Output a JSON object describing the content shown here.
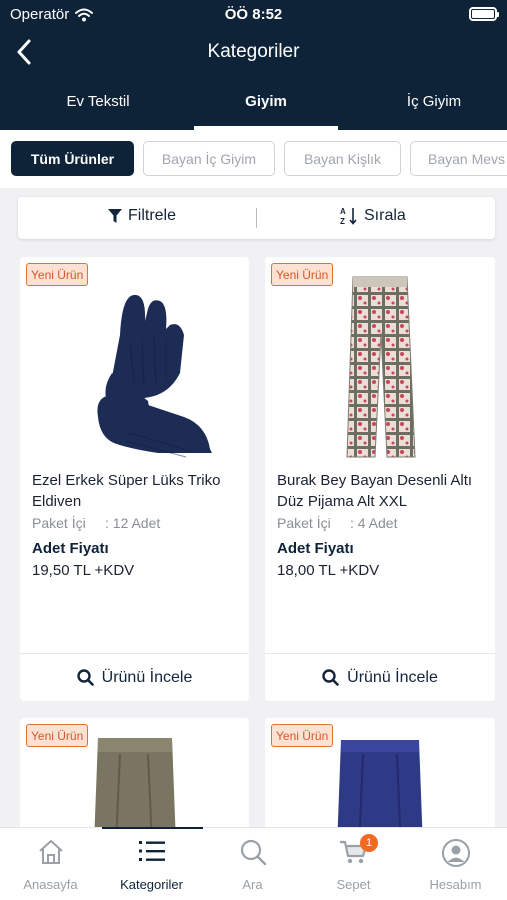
{
  "status_bar": {
    "carrier": "Operatör",
    "time": "ÖÖ 8:52"
  },
  "nav": {
    "title": "Kategoriler"
  },
  "category_tabs": [
    {
      "label": "Ev Tekstil"
    },
    {
      "label": "Giyim",
      "active": true
    },
    {
      "label": "İç Giyim"
    }
  ],
  "chips": [
    {
      "label": "Tüm Ürünler",
      "active": true
    },
    {
      "label": "Bayan İç Giyim"
    },
    {
      "label": "Bayan Kişlık"
    },
    {
      "label": "Bayan Mevs"
    }
  ],
  "filter_bar": {
    "filter_label": "Filtrele",
    "sort_label": "Sırala"
  },
  "products": [
    {
      "badge": "Yeni Ürün",
      "name": "Ezel Erkek Süper Lüks Triko Eldiven",
      "package_label": "Paket İçi",
      "package_value": ": 12 Adet",
      "price_label": "Adet Fiyatı",
      "price": "19,50 TL +KDV",
      "button_label": "Ürünü İncele"
    },
    {
      "badge": "Yeni Ürün",
      "name": "Burak Bey Bayan Desenli Altı Düz Pijama Alt XXL",
      "package_label": "Paket İçi",
      "package_value": ": 4 Adet",
      "price_label": "Adet Fiyatı",
      "price": "18,00 TL +KDV",
      "button_label": "Ürünü İncele"
    },
    {
      "badge": "Yeni Ürün"
    },
    {
      "badge": "Yeni Ürün"
    }
  ],
  "tab_bar": {
    "items": [
      {
        "label": "Anasayfa",
        "icon": "home-icon"
      },
      {
        "label": "Kategoriler",
        "icon": "list-icon",
        "active": true
      },
      {
        "label": "Ara",
        "icon": "search-icon"
      },
      {
        "label": "Sepet",
        "icon": "cart-icon",
        "badge": "1"
      },
      {
        "label": "Hesabım",
        "icon": "account-icon"
      }
    ]
  },
  "colors": {
    "primary": "#0e2238",
    "badge_border": "#e0703a",
    "badge_bg": "#fde1d2",
    "cart_badge": "#f26a21"
  }
}
